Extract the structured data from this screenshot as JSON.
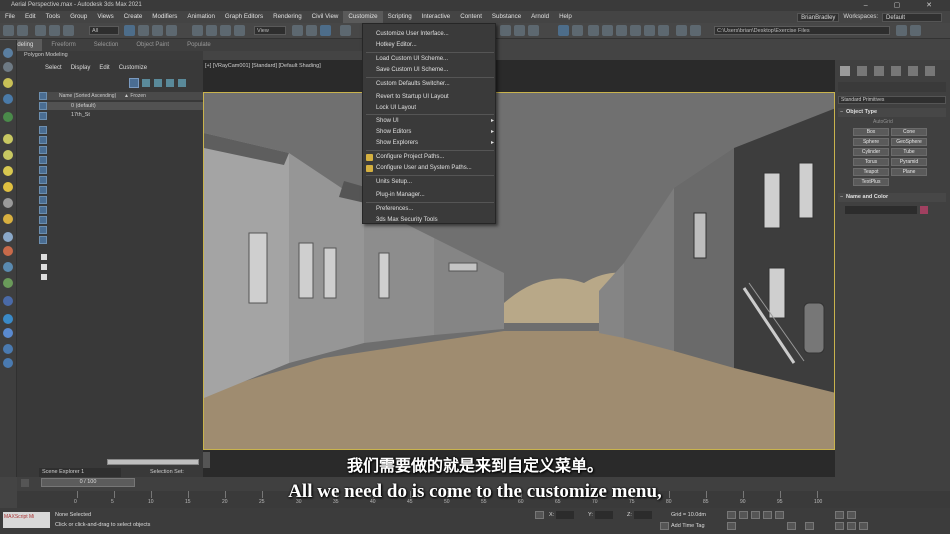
{
  "window": {
    "title": "Aerial Perspective.max - Autodesk 3ds Max 2021",
    "controls": "–  ▢  ✕"
  },
  "menubar": {
    "items": [
      "File",
      "Edit",
      "Tools",
      "Group",
      "Views",
      "Create",
      "Modifiers",
      "Animation",
      "Graph Editors",
      "Rendering",
      "Civil View",
      "Customize",
      "Scripting",
      "Interactive",
      "Content",
      "Substance",
      "Arnold",
      "Help"
    ],
    "active": "Customize",
    "user": "BrianBradley",
    "workspaces_label": "Workspaces:",
    "workspace_value": "Default"
  },
  "toolbar": {
    "selection_filter": "All",
    "coordinate_system": "View",
    "path_field": "C:\\Users\\brian\\Desktop\\Exercise Files"
  },
  "ribbon": {
    "tabs": [
      "Modeling",
      "Freeform",
      "Selection",
      "Object Paint",
      "Populate"
    ],
    "active": "Modeling",
    "sublabel": "Polygon Modeling"
  },
  "scene_explorer": {
    "menu": [
      "Select",
      "Display",
      "Edit",
      "Customize"
    ],
    "header_name": "Name (Sorted Ascending)",
    "header_frozen": "▲ Frozen",
    "rows": [
      {
        "label": "0 (default)"
      },
      {
        "label": "17th_St"
      }
    ],
    "explorer_tab": "Scene Explorer 1",
    "selection_set": "Selection Set:"
  },
  "viewport": {
    "label": "[+] [VRayCam001] [Standard] [Default Shading]"
  },
  "customize_menu": {
    "items": [
      {
        "label": "Customize User Interface...",
        "submenu": false
      },
      {
        "label": "Hotkey Editor...",
        "submenu": false
      },
      {
        "label": "Load Custom UI Scheme...",
        "submenu": false
      },
      {
        "label": "Save Custom UI Scheme...",
        "submenu": false
      },
      {
        "label": "Custom Defaults Switcher...",
        "submenu": false
      },
      {
        "label": "Revert to Startup UI Layout",
        "submenu": false
      },
      {
        "label": "Lock UI Layout",
        "submenu": false
      },
      {
        "label": "Show UI",
        "submenu": true
      },
      {
        "label": "Show Editors",
        "submenu": true
      },
      {
        "label": "Show Explorers",
        "submenu": true
      },
      {
        "label": "Configure Project Paths...",
        "submenu": false
      },
      {
        "label": "Configure User and System Paths...",
        "submenu": false
      },
      {
        "label": "Units Setup...",
        "submenu": false
      },
      {
        "label": "Plug-in Manager...",
        "submenu": false
      },
      {
        "label": "Preferences...",
        "submenu": false
      },
      {
        "label": "3ds Max Security Tools",
        "submenu": false
      }
    ]
  },
  "command_panel": {
    "category": "Standard Primitives",
    "object_type_title": "Object Type",
    "autogrid": "AutoGrid",
    "buttons": [
      "Box",
      "Cone",
      "Sphere",
      "GeoSphere",
      "Cylinder",
      "Tube",
      "Torus",
      "Pyramid",
      "Teapot",
      "Plane",
      "TextPlus"
    ],
    "name_color_title": "Name and Color"
  },
  "timeline": {
    "slider": "0 / 100",
    "ticks": [
      "0",
      "5",
      "10",
      "15",
      "20",
      "25",
      "30",
      "35",
      "40",
      "45",
      "50",
      "55",
      "60",
      "65",
      "70",
      "75",
      "80",
      "85",
      "90",
      "95",
      "100"
    ]
  },
  "status": {
    "maxscript": "MAXScript Mi",
    "line1": "None Selected",
    "line2": "Click or click-and-drag to select objects",
    "x_label": "X:",
    "y_label": "Y:",
    "z_label": "Z:",
    "grid": "Grid = 10.0dm",
    "add_time_tag": "Add Time Tag"
  },
  "subtitles": {
    "cn": "我们需要做的就是来到自定义菜单。",
    "en": "All we need do is come to the customize menu,"
  },
  "colors": {
    "viewport_border": "#c9b34d",
    "ground": "#9f8c70",
    "sky": "#707070",
    "building": "#9a9a9a"
  }
}
